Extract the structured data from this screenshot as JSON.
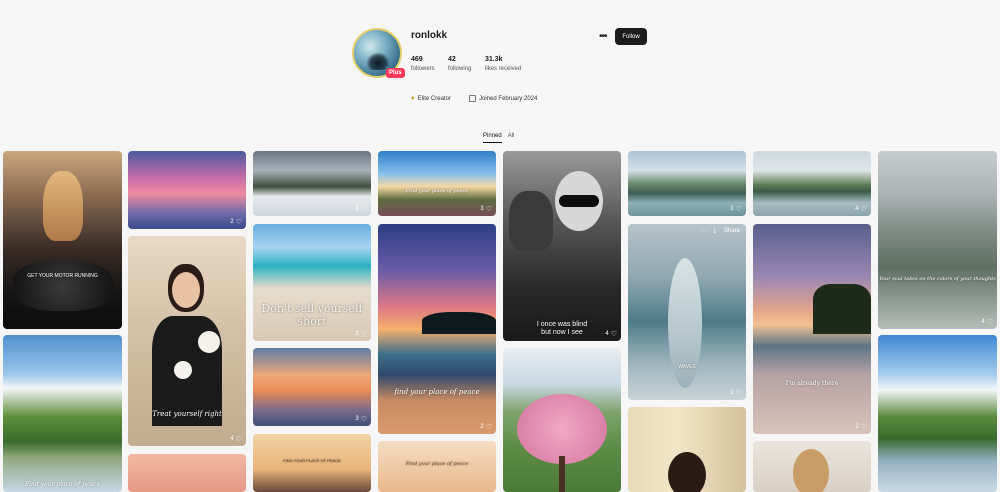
{
  "profile": {
    "username": "ronlokk",
    "badge": "Plus",
    "stats": [
      {
        "value": "469",
        "label": "followers"
      },
      {
        "value": "42",
        "label": "following"
      },
      {
        "value": "31.3k",
        "label": "likes received"
      }
    ],
    "more": "•••",
    "follow_label": "Follow",
    "creator_label": "Elite Creator",
    "joined_label": "Joined February 2024"
  },
  "tabs": [
    "Pinned",
    "All"
  ],
  "pins": {
    "c1": {
      "caption": "GET YOUR MOTOR RUNNING"
    },
    "c2": {
      "likes": "2"
    },
    "c3": {
      "likes": "3"
    },
    "c4": {
      "caption": "Find your place of peace",
      "likes": "3"
    },
    "c5": {
      "caption": "I once was blind\nbut now I see",
      "likes": "4"
    },
    "c6": {
      "likes": "1"
    },
    "c7": {
      "likes": "4"
    },
    "c8": {
      "caption": "Your soul takes on the colors of your thoughts",
      "likes": "4"
    },
    "c9": {
      "caption": "Don't sell yourself short",
      "likes": "3"
    },
    "c10": {
      "caption": "Treat yourself right",
      "likes": "4"
    },
    "c11": {
      "caption": "find your place of peace",
      "likes": "2"
    },
    "c12": {
      "share_label": "Share",
      "caption": "WAVES",
      "likes": "2"
    },
    "c13": {
      "caption": "I'm already there",
      "likes": "2"
    },
    "c14": {
      "likes": "3"
    },
    "c15": {
      "caption": "Find your place of peace"
    },
    "c16": {
      "caption": "Find your place of peace"
    },
    "c17": {
      "caption": "FIND YOUR PLACE OF PEACE"
    }
  },
  "colors": {
    "follow_bg": "#1c1c1c",
    "plus_badge": "#ff3b5c",
    "avatar_ring": "#e4cf6a"
  }
}
